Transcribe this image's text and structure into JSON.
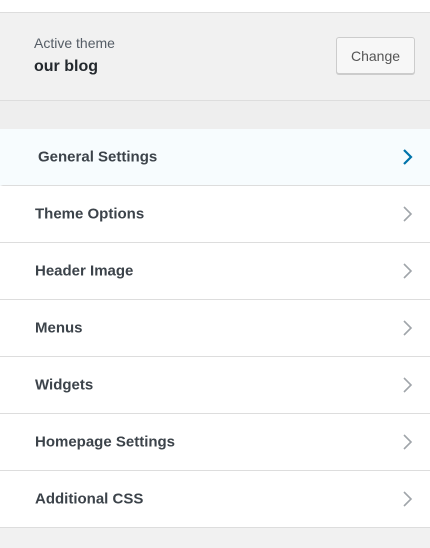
{
  "theme": {
    "caption": "Active theme",
    "name": "our blog",
    "change_label": "Change"
  },
  "panels": [
    {
      "label": "General Settings",
      "active": true
    },
    {
      "label": "Theme Options"
    },
    {
      "label": "Header Image"
    },
    {
      "label": "Menus"
    },
    {
      "label": "Widgets"
    },
    {
      "label": "Homepage Settings"
    },
    {
      "label": "Additional CSS"
    }
  ],
  "colors": {
    "accent": "#0073aa",
    "chevron": "#a0a5aa",
    "text": "#3c434a"
  },
  "icons": {
    "panel_arrow": "chevron-right-icon"
  }
}
